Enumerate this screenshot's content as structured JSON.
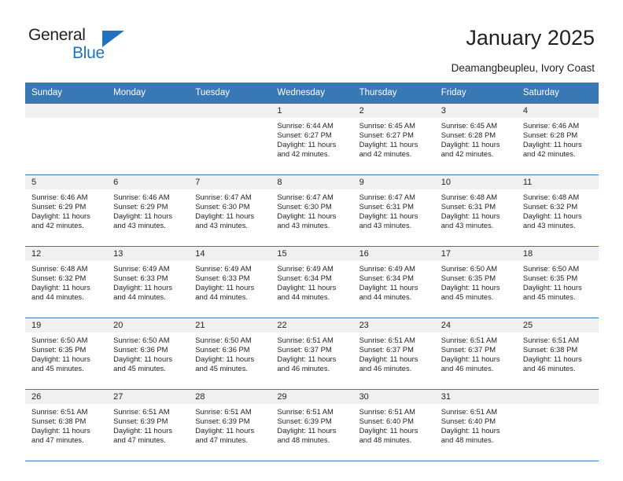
{
  "brand": {
    "name_dark": "General",
    "name_blue": "Blue",
    "accent_color": "#1f72bd",
    "header_color": "#3878b4"
  },
  "header": {
    "title": "January 2025",
    "location": "Deamangbeupleu, Ivory Coast"
  },
  "calendar": {
    "weekday_headers": [
      "Sunday",
      "Monday",
      "Tuesday",
      "Wednesday",
      "Thursday",
      "Friday",
      "Saturday"
    ],
    "labels": {
      "sunrise": "Sunrise:",
      "sunset": "Sunset:",
      "daylight": "Daylight:"
    },
    "weeks": [
      [
        {
          "day": "",
          "empty": true
        },
        {
          "day": "",
          "empty": true
        },
        {
          "day": "",
          "empty": true
        },
        {
          "day": "1",
          "sunrise": "Sunrise: 6:44 AM",
          "sunset": "Sunset: 6:27 PM",
          "daylight_1": "Daylight: 11 hours",
          "daylight_2": "and 42 minutes."
        },
        {
          "day": "2",
          "sunrise": "Sunrise: 6:45 AM",
          "sunset": "Sunset: 6:27 PM",
          "daylight_1": "Daylight: 11 hours",
          "daylight_2": "and 42 minutes."
        },
        {
          "day": "3",
          "sunrise": "Sunrise: 6:45 AM",
          "sunset": "Sunset: 6:28 PM",
          "daylight_1": "Daylight: 11 hours",
          "daylight_2": "and 42 minutes."
        },
        {
          "day": "4",
          "sunrise": "Sunrise: 6:46 AM",
          "sunset": "Sunset: 6:28 PM",
          "daylight_1": "Daylight: 11 hours",
          "daylight_2": "and 42 minutes."
        }
      ],
      [
        {
          "day": "5",
          "sunrise": "Sunrise: 6:46 AM",
          "sunset": "Sunset: 6:29 PM",
          "daylight_1": "Daylight: 11 hours",
          "daylight_2": "and 42 minutes."
        },
        {
          "day": "6",
          "sunrise": "Sunrise: 6:46 AM",
          "sunset": "Sunset: 6:29 PM",
          "daylight_1": "Daylight: 11 hours",
          "daylight_2": "and 43 minutes."
        },
        {
          "day": "7",
          "sunrise": "Sunrise: 6:47 AM",
          "sunset": "Sunset: 6:30 PM",
          "daylight_1": "Daylight: 11 hours",
          "daylight_2": "and 43 minutes."
        },
        {
          "day": "8",
          "sunrise": "Sunrise: 6:47 AM",
          "sunset": "Sunset: 6:30 PM",
          "daylight_1": "Daylight: 11 hours",
          "daylight_2": "and 43 minutes."
        },
        {
          "day": "9",
          "sunrise": "Sunrise: 6:47 AM",
          "sunset": "Sunset: 6:31 PM",
          "daylight_1": "Daylight: 11 hours",
          "daylight_2": "and 43 minutes."
        },
        {
          "day": "10",
          "sunrise": "Sunrise: 6:48 AM",
          "sunset": "Sunset: 6:31 PM",
          "daylight_1": "Daylight: 11 hours",
          "daylight_2": "and 43 minutes."
        },
        {
          "day": "11",
          "sunrise": "Sunrise: 6:48 AM",
          "sunset": "Sunset: 6:32 PM",
          "daylight_1": "Daylight: 11 hours",
          "daylight_2": "and 43 minutes."
        }
      ],
      [
        {
          "day": "12",
          "sunrise": "Sunrise: 6:48 AM",
          "sunset": "Sunset: 6:32 PM",
          "daylight_1": "Daylight: 11 hours",
          "daylight_2": "and 44 minutes."
        },
        {
          "day": "13",
          "sunrise": "Sunrise: 6:49 AM",
          "sunset": "Sunset: 6:33 PM",
          "daylight_1": "Daylight: 11 hours",
          "daylight_2": "and 44 minutes."
        },
        {
          "day": "14",
          "sunrise": "Sunrise: 6:49 AM",
          "sunset": "Sunset: 6:33 PM",
          "daylight_1": "Daylight: 11 hours",
          "daylight_2": "and 44 minutes."
        },
        {
          "day": "15",
          "sunrise": "Sunrise: 6:49 AM",
          "sunset": "Sunset: 6:34 PM",
          "daylight_1": "Daylight: 11 hours",
          "daylight_2": "and 44 minutes."
        },
        {
          "day": "16",
          "sunrise": "Sunrise: 6:49 AM",
          "sunset": "Sunset: 6:34 PM",
          "daylight_1": "Daylight: 11 hours",
          "daylight_2": "and 44 minutes."
        },
        {
          "day": "17",
          "sunrise": "Sunrise: 6:50 AM",
          "sunset": "Sunset: 6:35 PM",
          "daylight_1": "Daylight: 11 hours",
          "daylight_2": "and 45 minutes."
        },
        {
          "day": "18",
          "sunrise": "Sunrise: 6:50 AM",
          "sunset": "Sunset: 6:35 PM",
          "daylight_1": "Daylight: 11 hours",
          "daylight_2": "and 45 minutes."
        }
      ],
      [
        {
          "day": "19",
          "sunrise": "Sunrise: 6:50 AM",
          "sunset": "Sunset: 6:35 PM",
          "daylight_1": "Daylight: 11 hours",
          "daylight_2": "and 45 minutes."
        },
        {
          "day": "20",
          "sunrise": "Sunrise: 6:50 AM",
          "sunset": "Sunset: 6:36 PM",
          "daylight_1": "Daylight: 11 hours",
          "daylight_2": "and 45 minutes."
        },
        {
          "day": "21",
          "sunrise": "Sunrise: 6:50 AM",
          "sunset": "Sunset: 6:36 PM",
          "daylight_1": "Daylight: 11 hours",
          "daylight_2": "and 45 minutes."
        },
        {
          "day": "22",
          "sunrise": "Sunrise: 6:51 AM",
          "sunset": "Sunset: 6:37 PM",
          "daylight_1": "Daylight: 11 hours",
          "daylight_2": "and 46 minutes."
        },
        {
          "day": "23",
          "sunrise": "Sunrise: 6:51 AM",
          "sunset": "Sunset: 6:37 PM",
          "daylight_1": "Daylight: 11 hours",
          "daylight_2": "and 46 minutes."
        },
        {
          "day": "24",
          "sunrise": "Sunrise: 6:51 AM",
          "sunset": "Sunset: 6:37 PM",
          "daylight_1": "Daylight: 11 hours",
          "daylight_2": "and 46 minutes."
        },
        {
          "day": "25",
          "sunrise": "Sunrise: 6:51 AM",
          "sunset": "Sunset: 6:38 PM",
          "daylight_1": "Daylight: 11 hours",
          "daylight_2": "and 46 minutes."
        }
      ],
      [
        {
          "day": "26",
          "sunrise": "Sunrise: 6:51 AM",
          "sunset": "Sunset: 6:38 PM",
          "daylight_1": "Daylight: 11 hours",
          "daylight_2": "and 47 minutes."
        },
        {
          "day": "27",
          "sunrise": "Sunrise: 6:51 AM",
          "sunset": "Sunset: 6:39 PM",
          "daylight_1": "Daylight: 11 hours",
          "daylight_2": "and 47 minutes."
        },
        {
          "day": "28",
          "sunrise": "Sunrise: 6:51 AM",
          "sunset": "Sunset: 6:39 PM",
          "daylight_1": "Daylight: 11 hours",
          "daylight_2": "and 47 minutes."
        },
        {
          "day": "29",
          "sunrise": "Sunrise: 6:51 AM",
          "sunset": "Sunset: 6:39 PM",
          "daylight_1": "Daylight: 11 hours",
          "daylight_2": "and 48 minutes."
        },
        {
          "day": "30",
          "sunrise": "Sunrise: 6:51 AM",
          "sunset": "Sunset: 6:40 PM",
          "daylight_1": "Daylight: 11 hours",
          "daylight_2": "and 48 minutes."
        },
        {
          "day": "31",
          "sunrise": "Sunrise: 6:51 AM",
          "sunset": "Sunset: 6:40 PM",
          "daylight_1": "Daylight: 11 hours",
          "daylight_2": "and 48 minutes."
        },
        {
          "day": "",
          "empty": true
        }
      ]
    ]
  }
}
